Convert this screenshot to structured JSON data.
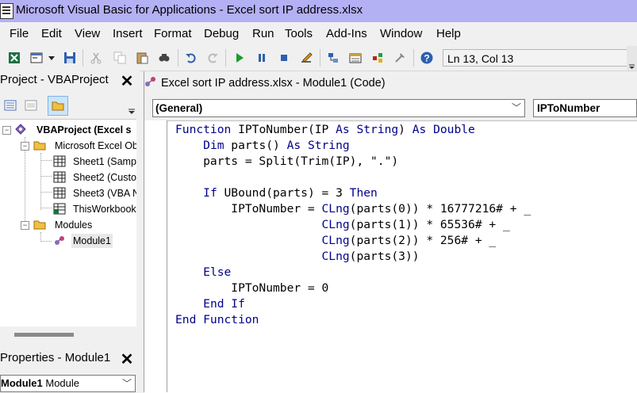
{
  "window": {
    "title": "Microsoft Visual Basic for Applications - Excel sort IP address.xlsx"
  },
  "menu": [
    "File",
    "Edit",
    "View",
    "Insert",
    "Format",
    "Debug",
    "Run",
    "Tools",
    "Add-Ins",
    "Window",
    "Help"
  ],
  "toolbar": {
    "icons": [
      "excel-icon",
      "insert-userform-icon",
      "dropdown-arrow-icon",
      "save-icon",
      "cut-icon",
      "copy-icon",
      "paste-icon",
      "find-icon",
      "undo-icon",
      "redo-icon",
      "run-icon",
      "break-icon",
      "reset-icon",
      "design-mode-icon",
      "project-explorer-icon",
      "properties-window-icon",
      "object-browser-icon",
      "toolbox-icon",
      "help-icon"
    ],
    "position": "Ln 13, Col 13"
  },
  "project_pane": {
    "title": "Project - VBAProject",
    "tree": {
      "root": "VBAProject (Excel s",
      "excel_objects_folder": "Microsoft Excel Ob",
      "sheets": [
        "Sheet1 (Samp",
        "Sheet2 (Custo",
        "Sheet3 (VBA N",
        "ThisWorkbook"
      ],
      "modules_folder": "Modules",
      "module": "Module1"
    }
  },
  "properties_pane": {
    "title": "Properties - Module1",
    "object_name": "Module1",
    "object_type": "Module"
  },
  "code_window": {
    "title": "Excel sort IP address.xlsx - Module1 (Code)",
    "object_dropdown": "(General)",
    "procedure_dropdown": "IPToNumber",
    "code_lines": [
      [
        {
          "k": 1,
          "t": "Function"
        },
        {
          "k": 0,
          "t": " IPToNumber(IP "
        },
        {
          "k": 1,
          "t": "As String"
        },
        {
          "k": 0,
          "t": ") "
        },
        {
          "k": 1,
          "t": "As Double"
        }
      ],
      [
        {
          "k": 0,
          "t": "    "
        },
        {
          "k": 1,
          "t": "Dim"
        },
        {
          "k": 0,
          "t": " parts() "
        },
        {
          "k": 1,
          "t": "As String"
        }
      ],
      [
        {
          "k": 0,
          "t": "    parts = Split(Trim(IP), \".\")"
        }
      ],
      [
        {
          "k": 0,
          "t": ""
        }
      ],
      [
        {
          "k": 0,
          "t": "    "
        },
        {
          "k": 1,
          "t": "If"
        },
        {
          "k": 0,
          "t": " UBound(parts) = 3 "
        },
        {
          "k": 1,
          "t": "Then"
        }
      ],
      [
        {
          "k": 0,
          "t": "        IPToNumber = "
        },
        {
          "k": 1,
          "t": "CLng"
        },
        {
          "k": 0,
          "t": "(parts(0)) * 16777216# + _"
        }
      ],
      [
        {
          "k": 0,
          "t": "                     "
        },
        {
          "k": 1,
          "t": "CLng"
        },
        {
          "k": 0,
          "t": "(parts(1)) * 65536# + _"
        }
      ],
      [
        {
          "k": 0,
          "t": "                     "
        },
        {
          "k": 1,
          "t": "CLng"
        },
        {
          "k": 0,
          "t": "(parts(2)) * 256# + _"
        }
      ],
      [
        {
          "k": 0,
          "t": "                     "
        },
        {
          "k": 1,
          "t": "CLng"
        },
        {
          "k": 0,
          "t": "(parts(3))"
        }
      ],
      [
        {
          "k": 0,
          "t": "    "
        },
        {
          "k": 1,
          "t": "Else"
        }
      ],
      [
        {
          "k": 0,
          "t": "        IPToNumber = 0"
        }
      ],
      [
        {
          "k": 0,
          "t": "    "
        },
        {
          "k": 1,
          "t": "End If"
        }
      ],
      [
        {
          "k": 1,
          "t": "End Function"
        }
      ]
    ]
  },
  "colors": {
    "title_bar": "#b4b0f4",
    "keyword": "#00008b"
  }
}
